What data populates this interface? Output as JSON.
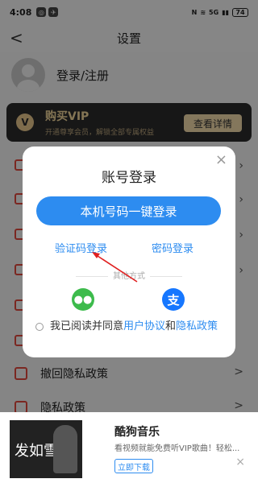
{
  "status": {
    "time": "4:08",
    "network": "5G",
    "battery": "74"
  },
  "nav": {
    "title": "设置",
    "back": "<"
  },
  "profile": {
    "label": "登录/注册"
  },
  "vip": {
    "badge": "V",
    "title": "购买VIP",
    "subtitle": "开通尊享会员，解锁全部专属权益",
    "button": "查看详情"
  },
  "rows": [
    {
      "label": "撤回隐私政策",
      "chevron": ">"
    },
    {
      "label": "隐私政策",
      "chevron": ">"
    }
  ],
  "dialog": {
    "close": "×",
    "title": "账号登录",
    "primary": "本机号码一键登录",
    "sms_login": "验证码登录",
    "password_login": "密码登录",
    "other_methods": "其他方式",
    "wechat_icon": "wechat-icon",
    "alipay_icon": "alipay-icon",
    "alipay_glyph": "支",
    "agree_prefix": "我已阅读并同意",
    "user_agreement": "用户协议",
    "and": "和",
    "privacy_policy": "隐私政策"
  },
  "ad": {
    "thumb_text": "发如雪",
    "name": "酷狗音乐",
    "desc": "看视频就能免费听VIP歌曲！轻松...",
    "download": "立即下载",
    "close": "×"
  },
  "colors": {
    "accent": "#2d8cf0",
    "vip_gold": "#e6c58b",
    "wechat": "#3dbb4c",
    "alipay": "#1677ff"
  }
}
